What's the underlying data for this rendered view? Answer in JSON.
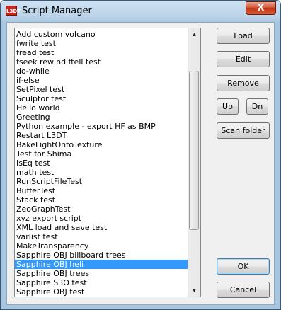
{
  "window": {
    "title": "Script Manager",
    "app_icon_text": "L3DT",
    "close_glyph": "X"
  },
  "scripts": {
    "items": [
      "Add custom volcano",
      "fwrite test",
      "fread test",
      "fseek rewind ftell test",
      "do-while",
      "if-else",
      "SetPixel test",
      "Sculptor test",
      "Hello world",
      "Greeting",
      "Python example - export HF as BMP",
      "Restart L3DT",
      "BakeLightOntoTexture",
      "Test for Shima",
      "IsEq test",
      "math test",
      "RunScriptFileTest",
      "BufferTest",
      "Stack test",
      "ZeoGraphTest",
      "xyz export script",
      "XML load and save test",
      "varlist test",
      "MakeTransparency",
      "Sapphire OBJ billboard trees",
      "Sapphire OBJ heli",
      "Sapphire OBJ trees",
      "Sapphire S3O test",
      "Sapphire OBJ test"
    ],
    "selected": "Sapphire OBJ heli"
  },
  "scrollbar": {
    "up_glyph": "▲",
    "down_glyph": "▼"
  },
  "buttons": {
    "load": "Load",
    "edit": "Edit",
    "remove": "Remove",
    "up": "Up",
    "down": "Dn",
    "scan_folder": "Scan folder",
    "ok": "OK",
    "cancel": "Cancel"
  }
}
